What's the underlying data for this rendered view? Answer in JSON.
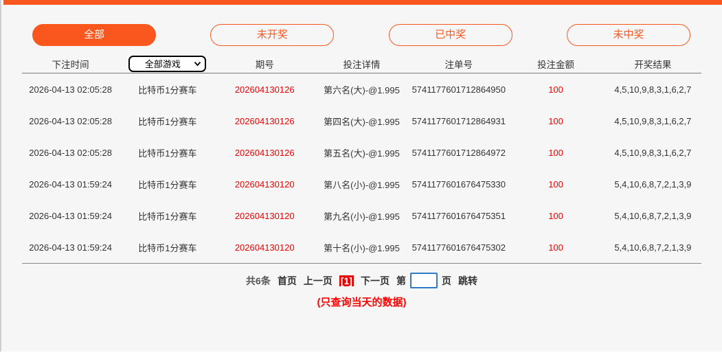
{
  "theme": {
    "accent_orange": "#fa571e",
    "red_text": "#ee0000",
    "current_page_bg": "#e60000",
    "input_border_blue": "#2f7ac9",
    "panel_bg": "#f6f6f6",
    "text_dark": "#333333"
  },
  "filters": [
    {
      "label": "全部",
      "active": true
    },
    {
      "label": "未开奖",
      "active": false
    },
    {
      "label": "已中奖",
      "active": false
    },
    {
      "label": "未中奖",
      "active": false
    }
  ],
  "table": {
    "headers": {
      "time": "下注时间",
      "issue": "期号",
      "detail": "投注详情",
      "order": "注单号",
      "amount": "投注金额",
      "result": "开奖结果"
    },
    "game_select": {
      "value": "全部游戏"
    },
    "rows": [
      [
        "2026-04-13 02:05:28",
        "比特币1分赛车",
        "202604130126",
        "第六名(大)-@1.995",
        "5741177601712864950",
        "100",
        "4,5,10,9,8,3,1,6,2,7"
      ],
      [
        "2026-04-13 02:05:28",
        "比特币1分赛车",
        "202604130126",
        "第四名(大)-@1.995",
        "5741177601712864931",
        "100",
        "4,5,10,9,8,3,1,6,2,7"
      ],
      [
        "2026-04-13 02:05:28",
        "比特币1分赛车",
        "202604130126",
        "第五名(大)-@1.995",
        "5741177601712864972",
        "100",
        "4,5,10,9,8,3,1,6,2,7"
      ],
      [
        "2026-04-13 01:59:24",
        "比特币1分赛车",
        "202604130120",
        "第八名(小)-@1.995",
        "5741177601676475330",
        "100",
        "5,4,10,6,8,7,2,1,3,9"
      ],
      [
        "2026-04-13 01:59:24",
        "比特币1分赛车",
        "202604130120",
        "第九名(小)-@1.995",
        "5741177601676475351",
        "100",
        "5,4,10,6,8,7,2,1,3,9"
      ],
      [
        "2026-04-13 01:59:24",
        "比特币1分赛车",
        "202604130120",
        "第十名(小)-@1.995",
        "5741177601676475302",
        "100",
        "5,4,10,6,8,7,2,1,3,9"
      ]
    ]
  },
  "pagination": {
    "total": "共6条",
    "first": "首页",
    "prev": "上一页",
    "current": "[1]",
    "next": "下一页",
    "page_prefix": "第",
    "page_suffix": "页",
    "jump": "跳转",
    "input_value": ""
  },
  "note": "(只查询当天的数据)"
}
